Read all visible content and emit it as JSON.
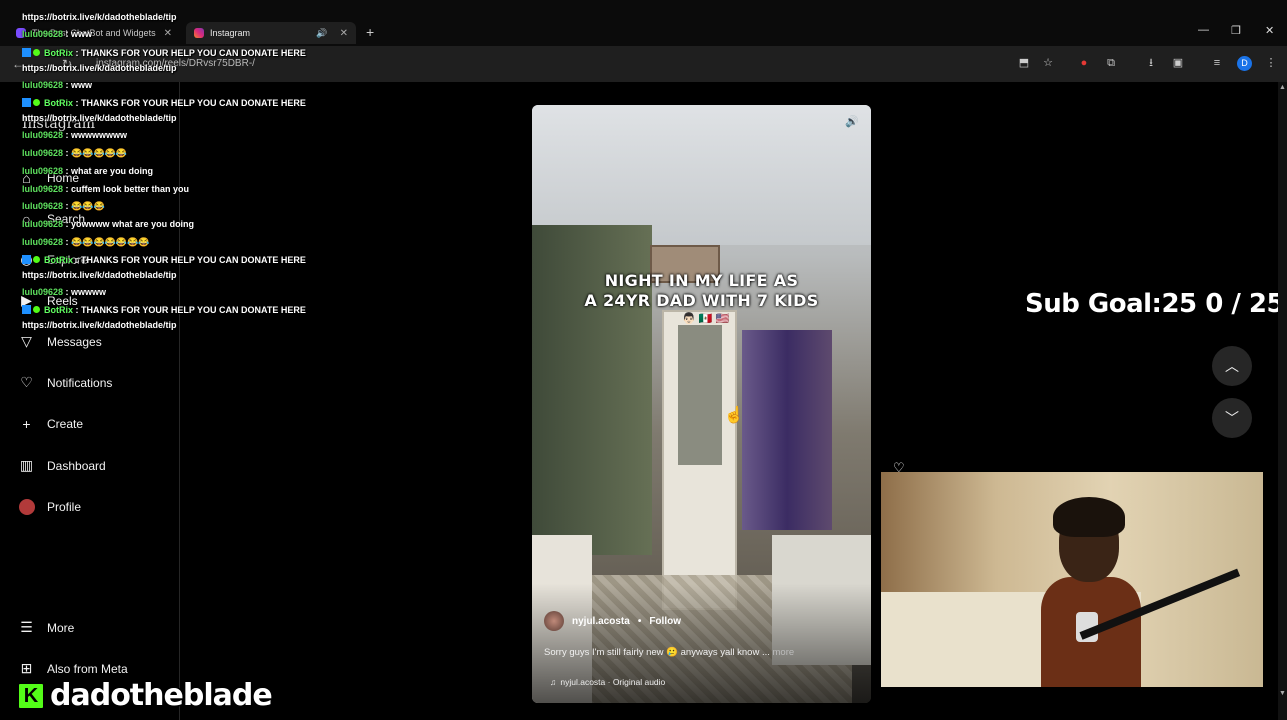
{
  "browser": {
    "tabs": [
      {
        "title": "The Best ChatBot and Widgets",
        "active": false
      },
      {
        "title": "Instagram",
        "active": true
      }
    ],
    "url": "instagram.com/reels/DRvsr75DBR-/",
    "profile_initial": "D"
  },
  "sidebar": {
    "logo": "Instagram",
    "items": [
      {
        "label": "Home",
        "icon": "home-icon"
      },
      {
        "label": "Search",
        "icon": "search-icon"
      },
      {
        "label": "Explore",
        "icon": "compass-icon"
      },
      {
        "label": "Reels",
        "icon": "reels-icon"
      },
      {
        "label": "Messages",
        "icon": "send-icon"
      },
      {
        "label": "Notifications",
        "icon": "heart-icon"
      },
      {
        "label": "Create",
        "icon": "plus-icon"
      },
      {
        "label": "Dashboard",
        "icon": "dashboard-icon"
      },
      {
        "label": "Profile",
        "icon": "avatar"
      },
      {
        "label": "More",
        "icon": "menu-icon"
      },
      {
        "label": "Also from Meta",
        "icon": "meta-icon"
      }
    ]
  },
  "reel": {
    "overlay_line1": "NIGHT IN MY LIFE AS",
    "overlay_line2": "A 24YR DAD WITH 7 KIDS",
    "overlay_emojis": "👨🏻 🇲🇽 🇺🇸",
    "author": "nyjul.acosta",
    "separator": "•",
    "follow_label": "Follow",
    "caption": "Sorry guys I'm still fairly new 🥲 anyways yall know ...",
    "more_label": "more",
    "audio": "nyjul.acosta · Original audio"
  },
  "stream_overlay": {
    "sub_goal": "Sub Goal:25  0 / 25",
    "channel": "dadotheblade",
    "chat": [
      {
        "user": "",
        "text": "https://botrix.live/k/dadotheblade/tip"
      },
      {
        "user": "lulu09628",
        "text": ": www"
      },
      {
        "user": "BotRix",
        "text": ": THANKS FOR YOUR HELP YOU CAN DONATE HERE"
      },
      {
        "user": "",
        "text": "https://botrix.live/k/dadotheblade/tip"
      },
      {
        "user": "lulu09628",
        "text": ": www"
      },
      {
        "user": "BotRix",
        "text": ": THANKS FOR YOUR HELP YOU CAN DONATE HERE"
      },
      {
        "user": "",
        "text": "https://botrix.live/k/dadotheblade/tip"
      },
      {
        "user": "lulu09628",
        "text": ": wwwwwwww"
      },
      {
        "user": "lulu09628",
        "text": ": 😂😂😂😂😂"
      },
      {
        "user": "lulu09628",
        "text": ": what are you doing"
      },
      {
        "user": "lulu09628",
        "text": ": cuffem look better than you"
      },
      {
        "user": "lulu09628",
        "text": ": 😂😂😂"
      },
      {
        "user": "lulu09628",
        "text": ": yowwww what are you doing"
      },
      {
        "user": "lulu09628",
        "text": ": 😂😂😂😂😂😂😂"
      },
      {
        "user": "BotRix",
        "text": ": THANKS FOR YOUR HELP YOU CAN DONATE HERE"
      },
      {
        "user": "",
        "text": "https://botrix.live/k/dadotheblade/tip"
      },
      {
        "user": "lulu09628",
        "text": ": wwwww"
      },
      {
        "user": "BotRix",
        "text": ": THANKS FOR YOUR HELP YOU CAN DONATE HERE"
      },
      {
        "user": "",
        "text": "https://botrix.live/k/dadotheblade/tip"
      }
    ]
  },
  "colors": {
    "accent_kick": "#53fc18",
    "profile_blue": "#1a73e8",
    "chat_user": "#5ee05e"
  }
}
